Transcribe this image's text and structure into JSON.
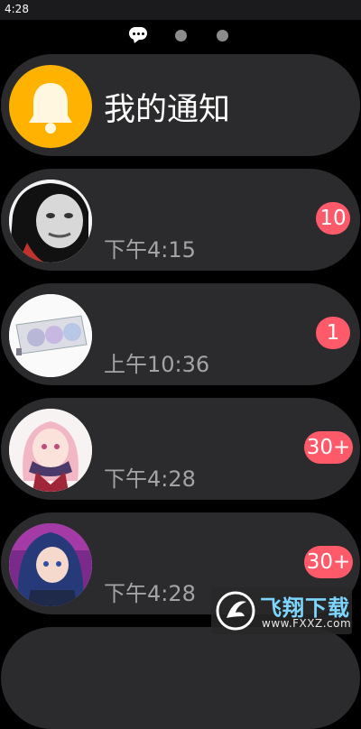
{
  "status_bar": {
    "time": "4:28"
  },
  "page_indicator": {
    "current_icon": "chat-bubble-icon"
  },
  "header_card": {
    "title": "我的通知",
    "icon": "bell-icon",
    "icon_bg": "#ffb300"
  },
  "conversations": [
    {
      "avatar": "meme-face-avatar",
      "time": "下午4:15",
      "unread": "10"
    },
    {
      "avatar": "graphics-card-avatar",
      "time": "上午10:36",
      "unread": "1"
    },
    {
      "avatar": "anime-girl-pink-hair-avatar",
      "time": "下午4:28",
      "unread": "30+"
    },
    {
      "avatar": "anime-girl-blue-hair-avatar",
      "time": "下午4:28",
      "unread": "30+"
    }
  ],
  "colors": {
    "badge": "#ff5a6a",
    "card": "#2b2b2d",
    "time_text": "#a4a4a4"
  },
  "watermark": {
    "brand_cn": "飞翔下载",
    "brand_en": "www.FXXZ.com"
  }
}
